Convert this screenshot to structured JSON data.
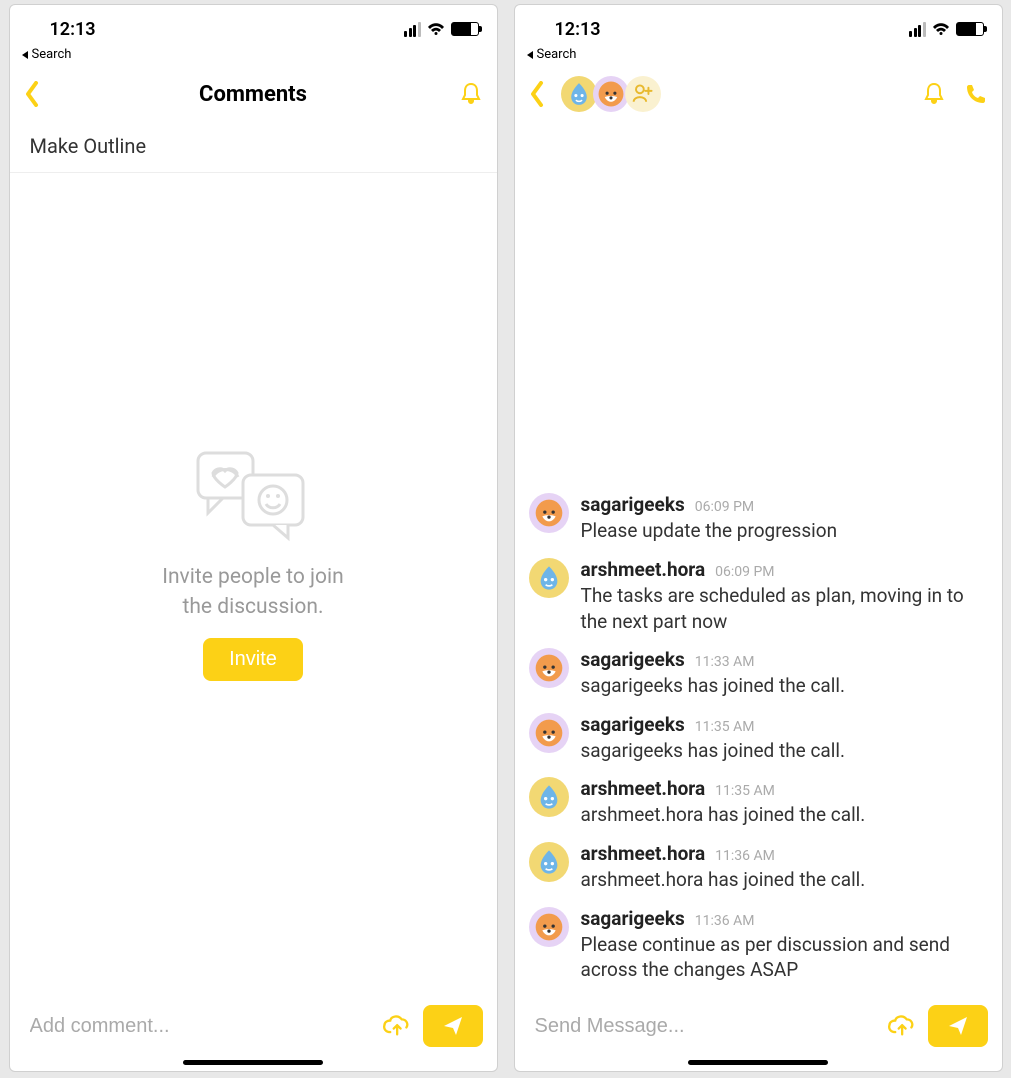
{
  "status": {
    "time": "12:13",
    "back_label": "Search"
  },
  "accent": "#fcd116",
  "left": {
    "title": "Comments",
    "subtitle": "Make Outline",
    "empty_line1": "Invite people to join",
    "empty_line2": "the discussion.",
    "invite_label": "Invite",
    "composer_placeholder": "Add comment..."
  },
  "right": {
    "composer_placeholder": "Send Message...",
    "avatars": [
      {
        "kind": "blue"
      },
      {
        "kind": "fox"
      },
      {
        "kind": "add"
      }
    ],
    "messages": [
      {
        "avatar": "fox",
        "user": "sagarigeeks",
        "time": "06:09 PM",
        "text": "Please update the progression"
      },
      {
        "avatar": "blue",
        "user": "arshmeet.hora",
        "time": "06:09 PM",
        "text": "The tasks are scheduled as plan, moving in to the next part now"
      },
      {
        "avatar": "fox",
        "user": "sagarigeeks",
        "time": "11:33 AM",
        "text": "sagarigeeks has joined the call."
      },
      {
        "avatar": "fox",
        "user": "sagarigeeks",
        "time": "11:35 AM",
        "text": "sagarigeeks has joined the call."
      },
      {
        "avatar": "blue",
        "user": "arshmeet.hora",
        "time": "11:35 AM",
        "text": "arshmeet.hora has joined the call."
      },
      {
        "avatar": "blue",
        "user": "arshmeet.hora",
        "time": "11:36 AM",
        "text": "arshmeet.hora has joined the call."
      },
      {
        "avatar": "fox",
        "user": "sagarigeeks",
        "time": "11:36 AM",
        "text": "Please continue as per discussion and send across the changes ASAP"
      }
    ]
  }
}
